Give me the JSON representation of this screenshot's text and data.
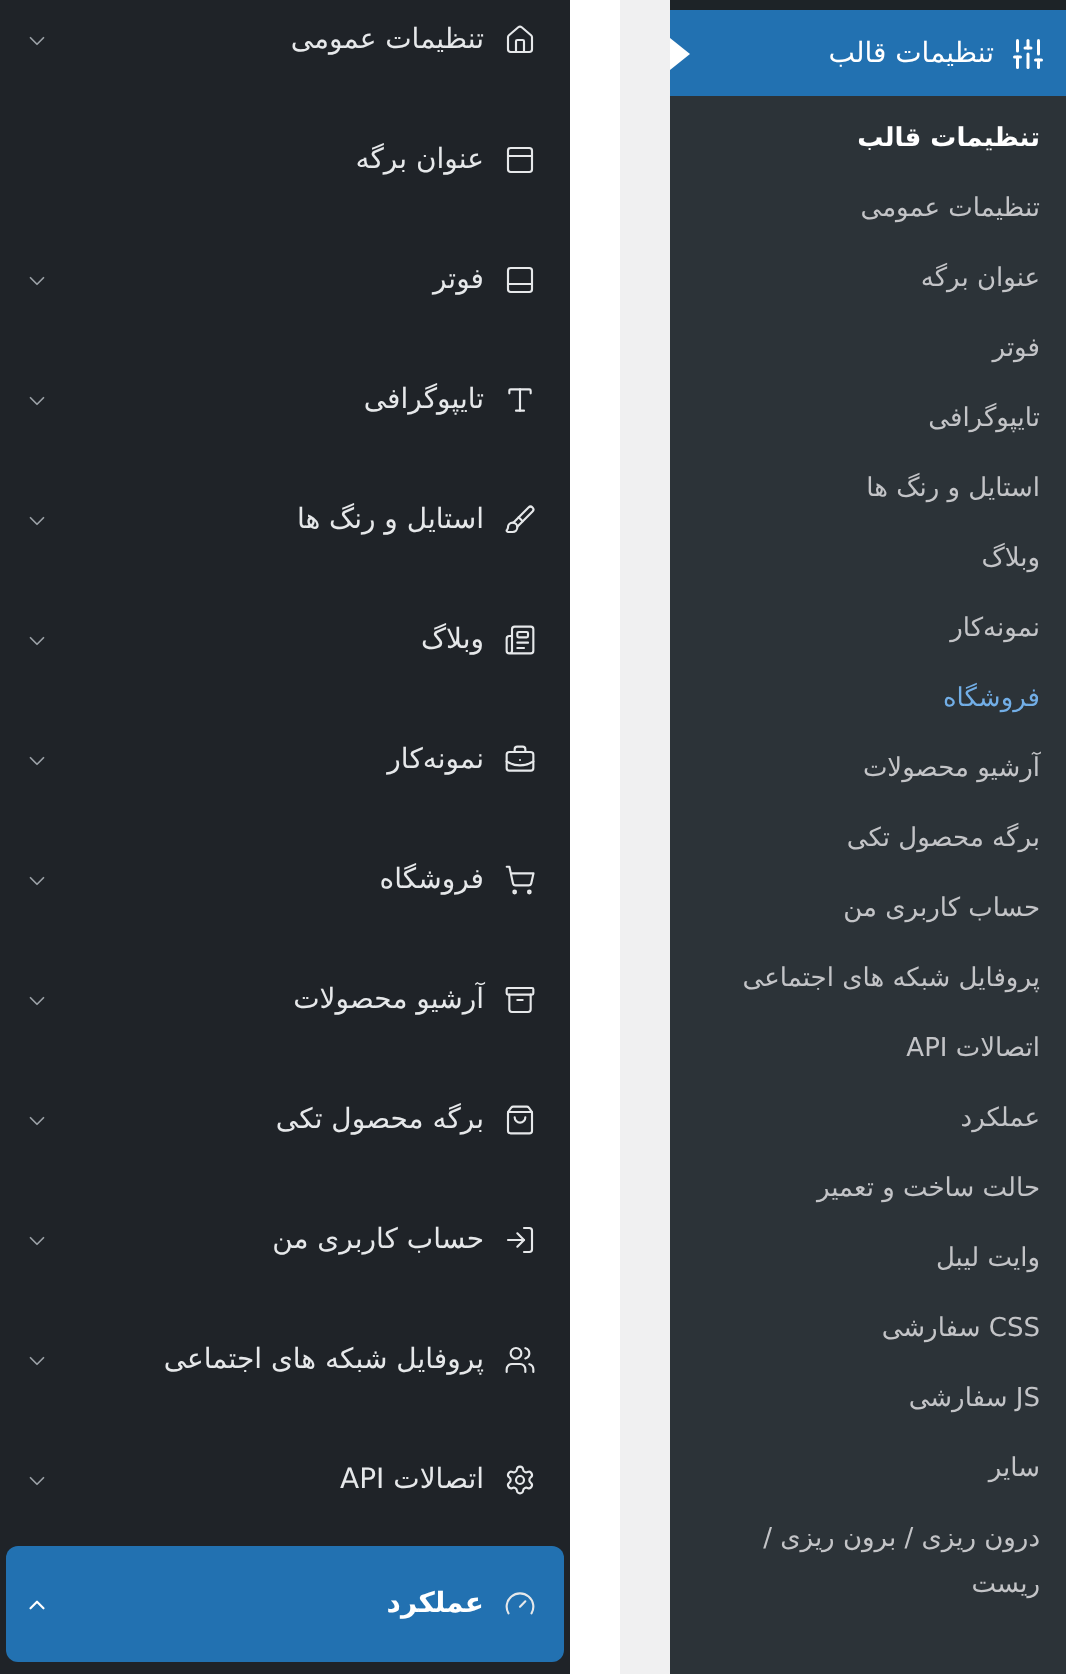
{
  "settings_menu": {
    "items": [
      {
        "label": "تنظیمات عمومی",
        "expandable": true,
        "expanded": false,
        "selected": false
      },
      {
        "label": "عنوان برگه",
        "expandable": false,
        "expanded": false,
        "selected": false
      },
      {
        "label": "فوتر",
        "expandable": true,
        "expanded": false,
        "selected": false
      },
      {
        "label": "تایپوگرافی",
        "expandable": true,
        "expanded": false,
        "selected": false
      },
      {
        "label": "استایل و رنگ ها",
        "expandable": true,
        "expanded": false,
        "selected": false
      },
      {
        "label": "وبلاگ",
        "expandable": true,
        "expanded": false,
        "selected": false
      },
      {
        "label": "نمونه‌کار",
        "expandable": true,
        "expanded": false,
        "selected": false
      },
      {
        "label": "فروشگاه",
        "expandable": true,
        "expanded": false,
        "selected": false
      },
      {
        "label": "آرشیو محصولات",
        "expandable": true,
        "expanded": false,
        "selected": false
      },
      {
        "label": "برگه محصول تکی",
        "expandable": true,
        "expanded": false,
        "selected": false
      },
      {
        "label": "حساب کاربری من",
        "expandable": true,
        "expanded": false,
        "selected": false
      },
      {
        "label": "پروفایل شبکه های اجتماعی",
        "expandable": true,
        "expanded": false,
        "selected": false
      },
      {
        "label": "اتصالات API",
        "expandable": true,
        "expanded": false,
        "selected": false
      },
      {
        "label": "عملکرد",
        "expandable": true,
        "expanded": true,
        "selected": true
      }
    ]
  },
  "admin_menu": {
    "header": {
      "label": "تنظیمات قالب"
    },
    "items": [
      {
        "label": "تنظیمات قالب",
        "selected": true,
        "hovered": false
      },
      {
        "label": "تنظیمات عمومی",
        "selected": false,
        "hovered": false
      },
      {
        "label": "عنوان برگه",
        "selected": false,
        "hovered": false
      },
      {
        "label": "فوتر",
        "selected": false,
        "hovered": false
      },
      {
        "label": "تایپوگرافی",
        "selected": false,
        "hovered": false
      },
      {
        "label": "استایل و رنگ ها",
        "selected": false,
        "hovered": false
      },
      {
        "label": "وبلاگ",
        "selected": false,
        "hovered": false
      },
      {
        "label": "نمونه‌کار",
        "selected": false,
        "hovered": false
      },
      {
        "label": "فروشگاه",
        "selected": false,
        "hovered": true
      },
      {
        "label": "آرشیو محصولات",
        "selected": false,
        "hovered": false
      },
      {
        "label": "برگه محصول تکی",
        "selected": false,
        "hovered": false
      },
      {
        "label": "حساب کاربری من",
        "selected": false,
        "hovered": false
      },
      {
        "label": "پروفایل شبکه های اجتماعی",
        "selected": false,
        "hovered": false
      },
      {
        "label": "اتصالات API",
        "selected": false,
        "hovered": false
      },
      {
        "label": "عملکرد",
        "selected": false,
        "hovered": false
      },
      {
        "label": "حالت ساخت و تعمیر",
        "selected": false,
        "hovered": false
      },
      {
        "label": "وایت لیبل",
        "selected": false,
        "hovered": false
      },
      {
        "label": "CSS سفارشی",
        "selected": false,
        "hovered": false
      },
      {
        "label": "JS سفارشی",
        "selected": false,
        "hovered": false
      },
      {
        "label": "سایر",
        "selected": false,
        "hovered": false
      },
      {
        "label": "درون ریزی / برون ریزی / ریست",
        "selected": false,
        "hovered": false
      }
    ]
  }
}
